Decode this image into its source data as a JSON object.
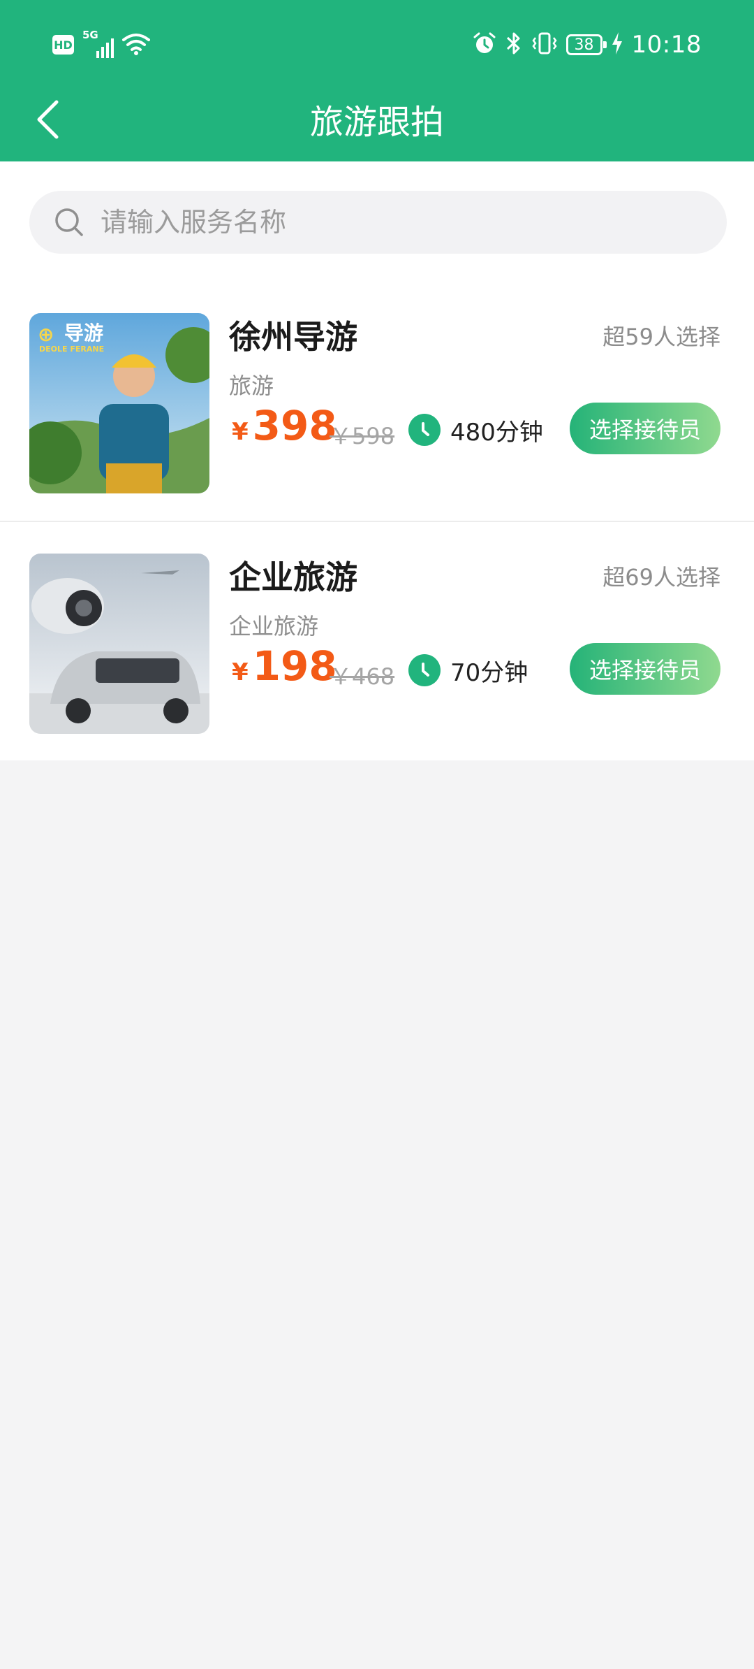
{
  "status_bar": {
    "hd": "HD",
    "network": "5G",
    "battery": "38",
    "time": "10:18"
  },
  "nav": {
    "title": "旅游跟拍"
  },
  "search": {
    "placeholder": "请输入服务名称",
    "value": ""
  },
  "services": [
    {
      "title": "徐州导游",
      "chosen": "超59人选择",
      "subtitle": "旅游",
      "currency": "¥",
      "price": "398",
      "original_price": "￥598",
      "duration": "480分钟",
      "button": "选择接待员",
      "thumb_text": "导游",
      "thumb_small": "DEOLE FERANE"
    },
    {
      "title": "企业旅游",
      "chosen": "超69人选择",
      "subtitle": "企业旅游",
      "currency": "¥",
      "price": "198",
      "original_price": "￥468",
      "duration": "70分钟",
      "button": "选择接待员"
    }
  ],
  "colors": {
    "brand_green": "#21b47d",
    "price_orange": "#f35a16",
    "button_gradient_start": "#25b378",
    "button_gradient_end": "#90d98f"
  }
}
